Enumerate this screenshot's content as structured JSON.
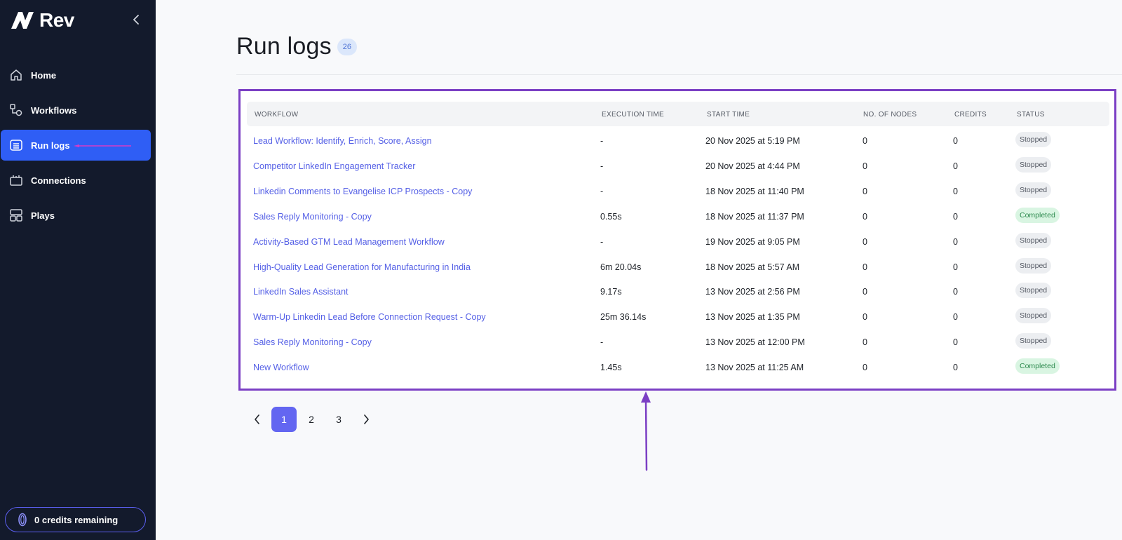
{
  "sidebar": {
    "brand": "Rev",
    "items": [
      {
        "label": "Home",
        "icon": "home-icon"
      },
      {
        "label": "Workflows",
        "icon": "workflow-icon"
      },
      {
        "label": "Run logs",
        "icon": "run-logs-icon",
        "active": true
      },
      {
        "label": "Connections",
        "icon": "connections-icon"
      },
      {
        "label": "Plays",
        "icon": "plays-icon"
      }
    ],
    "credits_label": "0 credits remaining"
  },
  "page": {
    "title": "Run logs",
    "count": "26"
  },
  "table": {
    "headers": [
      "WORKFLOW",
      "EXECUTION TIME",
      "START TIME",
      "NO. OF NODES",
      "CREDITS",
      "STATUS"
    ],
    "rows": [
      {
        "workflow": "Lead Workflow: Identify, Enrich, Score, Assign",
        "execution_time": "-",
        "start_time": "20 Nov 2025 at 5:19 PM",
        "nodes": "0",
        "credits": "0",
        "status": "Stopped"
      },
      {
        "workflow": "Competitor LinkedIn Engagement Tracker",
        "execution_time": "-",
        "start_time": "20 Nov 2025 at 4:44 PM",
        "nodes": "0",
        "credits": "0",
        "status": "Stopped"
      },
      {
        "workflow": "Linkedin Comments to Evangelise ICP Prospects - Copy",
        "execution_time": "-",
        "start_time": "18 Nov 2025 at 11:40 PM",
        "nodes": "0",
        "credits": "0",
        "status": "Stopped"
      },
      {
        "workflow": "Sales Reply Monitoring - Copy",
        "execution_time": "0.55s",
        "start_time": "18 Nov 2025 at 11:37 PM",
        "nodes": "0",
        "credits": "0",
        "status": "Completed"
      },
      {
        "workflow": "Activity-Based GTM Lead Management Workflow",
        "execution_time": "-",
        "start_time": "19 Nov 2025 at 9:05 PM",
        "nodes": "0",
        "credits": "0",
        "status": "Stopped"
      },
      {
        "workflow": "High-Quality Lead Generation for Manufacturing in India",
        "execution_time": "6m 20.04s",
        "start_time": "18 Nov 2025 at 5:57 AM",
        "nodes": "0",
        "credits": "0",
        "status": "Stopped"
      },
      {
        "workflow": "LinkedIn Sales Assistant",
        "execution_time": "9.17s",
        "start_time": "13 Nov 2025 at 2:56 PM",
        "nodes": "0",
        "credits": "0",
        "status": "Stopped"
      },
      {
        "workflow": "Warm-Up Linkedin Lead Before Connection Request - Copy",
        "execution_time": "25m 36.14s",
        "start_time": "13 Nov 2025 at 1:35 PM",
        "nodes": "0",
        "credits": "0",
        "status": "Stopped"
      },
      {
        "workflow": "Sales Reply Monitoring - Copy",
        "execution_time": "-",
        "start_time": "13 Nov 2025 at 12:00 PM",
        "nodes": "0",
        "credits": "0",
        "status": "Stopped"
      },
      {
        "workflow": "New Workflow",
        "execution_time": "1.45s",
        "start_time": "13 Nov 2025 at 11:25 AM",
        "nodes": "0",
        "credits": "0",
        "status": "Completed"
      }
    ]
  },
  "pagination": {
    "pages": [
      "1",
      "2",
      "3"
    ],
    "current": "1"
  },
  "colors": {
    "sidebar_bg": "#131a2c",
    "active_nav": "#2f5ef5",
    "link": "#5560e6",
    "annotation_purple": "#7b3fc4",
    "annotation_pink": "#d63cc8",
    "pager_active": "#6366f1"
  }
}
